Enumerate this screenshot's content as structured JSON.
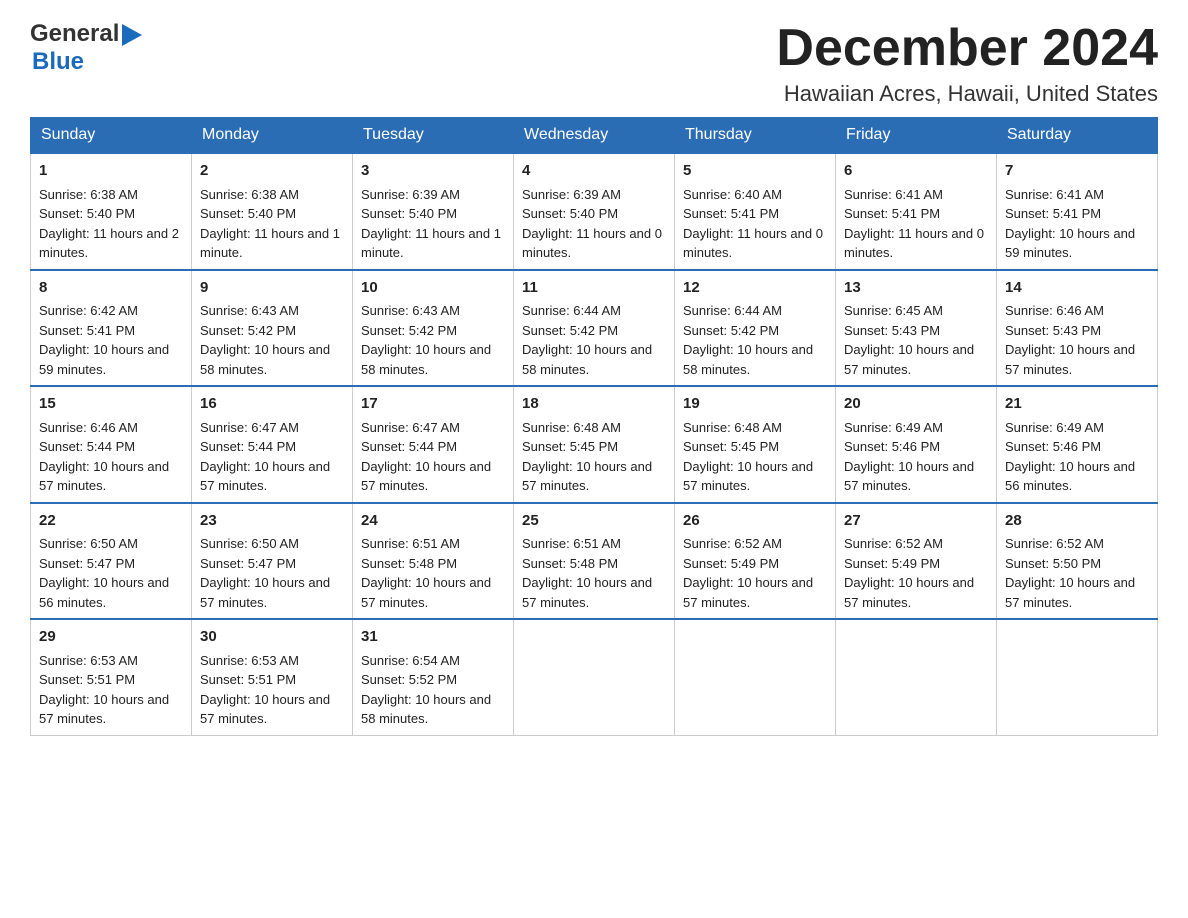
{
  "header": {
    "logo_general": "General",
    "logo_blue": "Blue",
    "month_title": "December 2024",
    "location": "Hawaiian Acres, Hawaii, United States"
  },
  "days_of_week": [
    "Sunday",
    "Monday",
    "Tuesday",
    "Wednesday",
    "Thursday",
    "Friday",
    "Saturday"
  ],
  "weeks": [
    [
      {
        "day": "1",
        "sunrise": "6:38 AM",
        "sunset": "5:40 PM",
        "daylight": "11 hours and 2 minutes."
      },
      {
        "day": "2",
        "sunrise": "6:38 AM",
        "sunset": "5:40 PM",
        "daylight": "11 hours and 1 minute."
      },
      {
        "day": "3",
        "sunrise": "6:39 AM",
        "sunset": "5:40 PM",
        "daylight": "11 hours and 1 minute."
      },
      {
        "day": "4",
        "sunrise": "6:39 AM",
        "sunset": "5:40 PM",
        "daylight": "11 hours and 0 minutes."
      },
      {
        "day": "5",
        "sunrise": "6:40 AM",
        "sunset": "5:41 PM",
        "daylight": "11 hours and 0 minutes."
      },
      {
        "day": "6",
        "sunrise": "6:41 AM",
        "sunset": "5:41 PM",
        "daylight": "11 hours and 0 minutes."
      },
      {
        "day": "7",
        "sunrise": "6:41 AM",
        "sunset": "5:41 PM",
        "daylight": "10 hours and 59 minutes."
      }
    ],
    [
      {
        "day": "8",
        "sunrise": "6:42 AM",
        "sunset": "5:41 PM",
        "daylight": "10 hours and 59 minutes."
      },
      {
        "day": "9",
        "sunrise": "6:43 AM",
        "sunset": "5:42 PM",
        "daylight": "10 hours and 58 minutes."
      },
      {
        "day": "10",
        "sunrise": "6:43 AM",
        "sunset": "5:42 PM",
        "daylight": "10 hours and 58 minutes."
      },
      {
        "day": "11",
        "sunrise": "6:44 AM",
        "sunset": "5:42 PM",
        "daylight": "10 hours and 58 minutes."
      },
      {
        "day": "12",
        "sunrise": "6:44 AM",
        "sunset": "5:42 PM",
        "daylight": "10 hours and 58 minutes."
      },
      {
        "day": "13",
        "sunrise": "6:45 AM",
        "sunset": "5:43 PM",
        "daylight": "10 hours and 57 minutes."
      },
      {
        "day": "14",
        "sunrise": "6:46 AM",
        "sunset": "5:43 PM",
        "daylight": "10 hours and 57 minutes."
      }
    ],
    [
      {
        "day": "15",
        "sunrise": "6:46 AM",
        "sunset": "5:44 PM",
        "daylight": "10 hours and 57 minutes."
      },
      {
        "day": "16",
        "sunrise": "6:47 AM",
        "sunset": "5:44 PM",
        "daylight": "10 hours and 57 minutes."
      },
      {
        "day": "17",
        "sunrise": "6:47 AM",
        "sunset": "5:44 PM",
        "daylight": "10 hours and 57 minutes."
      },
      {
        "day": "18",
        "sunrise": "6:48 AM",
        "sunset": "5:45 PM",
        "daylight": "10 hours and 57 minutes."
      },
      {
        "day": "19",
        "sunrise": "6:48 AM",
        "sunset": "5:45 PM",
        "daylight": "10 hours and 57 minutes."
      },
      {
        "day": "20",
        "sunrise": "6:49 AM",
        "sunset": "5:46 PM",
        "daylight": "10 hours and 57 minutes."
      },
      {
        "day": "21",
        "sunrise": "6:49 AM",
        "sunset": "5:46 PM",
        "daylight": "10 hours and 56 minutes."
      }
    ],
    [
      {
        "day": "22",
        "sunrise": "6:50 AM",
        "sunset": "5:47 PM",
        "daylight": "10 hours and 56 minutes."
      },
      {
        "day": "23",
        "sunrise": "6:50 AM",
        "sunset": "5:47 PM",
        "daylight": "10 hours and 57 minutes."
      },
      {
        "day": "24",
        "sunrise": "6:51 AM",
        "sunset": "5:48 PM",
        "daylight": "10 hours and 57 minutes."
      },
      {
        "day": "25",
        "sunrise": "6:51 AM",
        "sunset": "5:48 PM",
        "daylight": "10 hours and 57 minutes."
      },
      {
        "day": "26",
        "sunrise": "6:52 AM",
        "sunset": "5:49 PM",
        "daylight": "10 hours and 57 minutes."
      },
      {
        "day": "27",
        "sunrise": "6:52 AM",
        "sunset": "5:49 PM",
        "daylight": "10 hours and 57 minutes."
      },
      {
        "day": "28",
        "sunrise": "6:52 AM",
        "sunset": "5:50 PM",
        "daylight": "10 hours and 57 minutes."
      }
    ],
    [
      {
        "day": "29",
        "sunrise": "6:53 AM",
        "sunset": "5:51 PM",
        "daylight": "10 hours and 57 minutes."
      },
      {
        "day": "30",
        "sunrise": "6:53 AM",
        "sunset": "5:51 PM",
        "daylight": "10 hours and 57 minutes."
      },
      {
        "day": "31",
        "sunrise": "6:54 AM",
        "sunset": "5:52 PM",
        "daylight": "10 hours and 58 minutes."
      },
      null,
      null,
      null,
      null
    ]
  ]
}
